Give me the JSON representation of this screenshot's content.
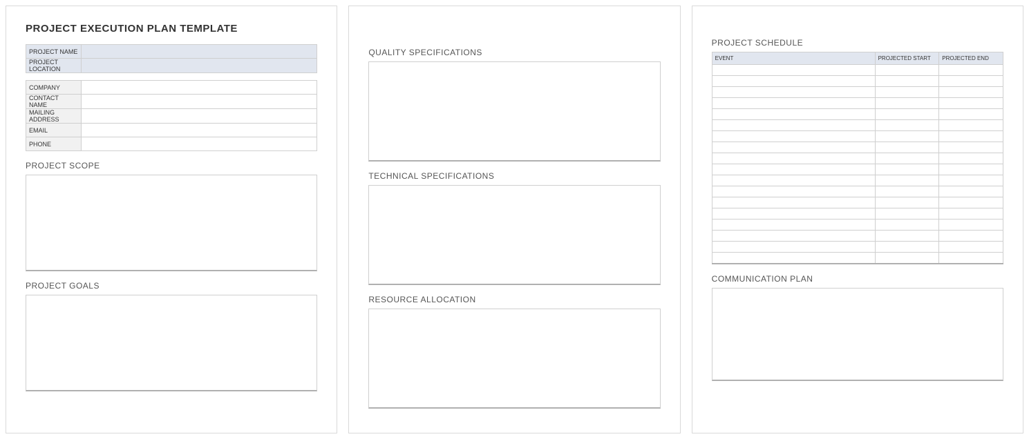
{
  "title": "PROJECT EXECUTION PLAN TEMPLATE",
  "header_fields": [
    {
      "label": "PROJECT NAME",
      "value": ""
    },
    {
      "label": "PROJECT LOCATION",
      "value": ""
    }
  ],
  "contact_fields": [
    {
      "label": "COMPANY",
      "value": ""
    },
    {
      "label": "CONTACT NAME",
      "value": ""
    },
    {
      "label": "MAILING ADDRESS",
      "value": ""
    },
    {
      "label": "EMAIL",
      "value": ""
    },
    {
      "label": "PHONE",
      "value": ""
    }
  ],
  "sections": {
    "scope": "PROJECT SCOPE",
    "goals": "PROJECT GOALS",
    "quality": "QUALITY SPECIFICATIONS",
    "technical": "TECHNICAL SPECIFICATIONS",
    "resource": "RESOURCE ALLOCATION",
    "schedule": "PROJECT SCHEDULE",
    "communication": "COMMUNICATION PLAN"
  },
  "schedule": {
    "columns": [
      "EVENT",
      "PROJECTED START",
      "PROJECTED END"
    ],
    "rows": [
      [
        "",
        "",
        ""
      ],
      [
        "",
        "",
        ""
      ],
      [
        "",
        "",
        ""
      ],
      [
        "",
        "",
        ""
      ],
      [
        "",
        "",
        ""
      ],
      [
        "",
        "",
        ""
      ],
      [
        "",
        "",
        ""
      ],
      [
        "",
        "",
        ""
      ],
      [
        "",
        "",
        ""
      ],
      [
        "",
        "",
        ""
      ],
      [
        "",
        "",
        ""
      ],
      [
        "",
        "",
        ""
      ],
      [
        "",
        "",
        ""
      ],
      [
        "",
        "",
        ""
      ],
      [
        "",
        "",
        ""
      ],
      [
        "",
        "",
        ""
      ],
      [
        "",
        "",
        ""
      ],
      [
        "",
        "",
        ""
      ]
    ]
  }
}
